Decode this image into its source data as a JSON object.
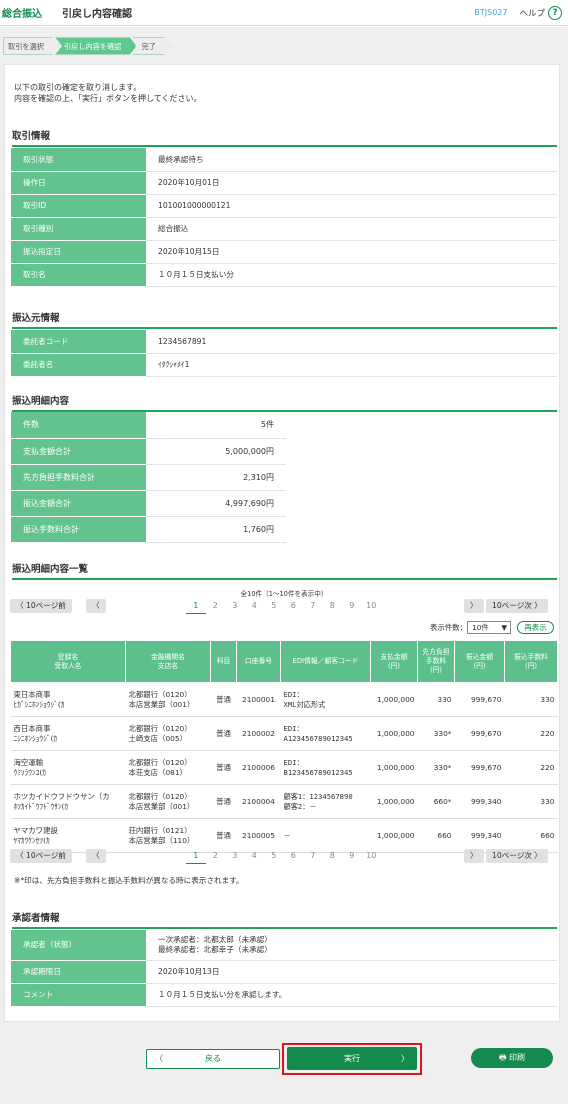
{
  "header": {
    "brand": "総合振込",
    "title": "引戻し内容確認",
    "screen_id": "BTJS027",
    "help": "ヘルプ",
    "help_icon": "?"
  },
  "steps": [
    "取引を選択",
    "引戻し内容を確認",
    "完了"
  ],
  "intro": [
    "以下の取引の確定を取り消します。",
    "内容を確認の上、「実行」ボタンを押してください。"
  ],
  "sections": {
    "txn": "取引情報",
    "from": "振込元情報",
    "detail": "振込明細内容",
    "list": "振込明細内容一覧",
    "approver": "承認者情報"
  },
  "txn": [
    [
      "取引状態",
      "最終承認待ち"
    ],
    [
      "操作日",
      "2020年10月01日"
    ],
    [
      "取引ID",
      "101001000000121"
    ],
    [
      "取引種別",
      "総合振込"
    ],
    [
      "振込指定日",
      "2020年10月15日"
    ],
    [
      "取引名",
      "１０月１５日支払い分"
    ]
  ],
  "from": [
    [
      "委託者コード",
      "1234567891"
    ],
    [
      "委託者名",
      "ｲﾀｸｼｬﾒｲ1"
    ]
  ],
  "detail": [
    [
      "件数",
      "5件"
    ],
    [
      "支払金額合計",
      "5,000,000円"
    ],
    [
      "先方負担手数料合計",
      "2,310円"
    ],
    [
      "振込金額合計",
      "4,997,690円"
    ],
    [
      "振込手数料合計",
      "1,760円"
    ]
  ],
  "pager": {
    "prev": "10ページ前",
    "next": "10ページ次",
    "pages": [
      "1",
      "2",
      "3",
      "4",
      "5",
      "6",
      "7",
      "8",
      "9",
      "10"
    ],
    "total": "全10件（1～10件を表示中）"
  },
  "display": {
    "label": "表示件数：",
    "value": "10件",
    "redisplay": "再表示"
  },
  "columns": [
    "登録名\n受取人名",
    "金融機関名\n支店名",
    "科目",
    "口座番号",
    "EDI情報／顧客コード",
    "支払金額\n(円)",
    "先方負担\n手数料\n(円)",
    "振込金額\n(円)",
    "振込手数料\n(円)"
  ],
  "rows": [
    [
      "東日本商事\nﾋｶﾞｼﾆﾎﾝｼｮｳｼﾞ(ｶ",
      "北都銀行（0120）\n本店営業部（001）",
      "普通",
      "2100001",
      "EDI：\nXML対応形式",
      "1,000,000",
      "330",
      "999,670",
      "330"
    ],
    [
      "西日本商事\nﾆｼﾆﾎﾝｼｮｳｼﾞ(ｶ",
      "北都銀行（0120）\n土崎支店（005）",
      "普通",
      "2100002",
      "EDI：\nA123456789012345",
      "1,000,000",
      "330*",
      "999,670",
      "220"
    ],
    [
      "海空運輸\nｳﾐｿﾗｳﾝﾕ(ｶ",
      "北都銀行（0120）\n本荘支店（081）",
      "普通",
      "2100006",
      "EDI：\nB123456789012345",
      "1,000,000",
      "330*",
      "999,670",
      "220"
    ],
    [
      "ホツカイドウフドウサン（カ\nﾎﾂｶｲﾄﾞｳﾌﾄﾞｳｻﾝ(ｶ",
      "北都銀行（0120）\n本店営業部（001）",
      "普通",
      "2100004",
      "顧客1：1234567890\n顧客2：－",
      "1,000,000",
      "660*",
      "999,340",
      "330"
    ],
    [
      "ヤマカワ建設\nﾔﾏｶﾜｹﾝｾﾂ(ｶ",
      "荘内銀行（0121）\n本店営業部（110）",
      "普通",
      "2100005",
      "－",
      "1,000,000",
      "660",
      "999,340",
      "660"
    ]
  ],
  "note": "※*印は、先方負担手数料と振込手数料が異なる時に表示されます。",
  "approver": [
    [
      "承認者（状態）",
      "一次承認者：北都太郎（未承認）\n最終承認者：北都幸子（未承認）"
    ],
    [
      "承認期限日",
      "2020年10月13日"
    ],
    [
      "コメント",
      "１０月１５日支払い分を承認します。"
    ]
  ],
  "buttons": {
    "back": "戻る",
    "execute": "実行",
    "print": "印刷"
  },
  "colors": {
    "accent": "#148a4e",
    "header_cell": "#62c38f",
    "highlight": "#e0141e"
  }
}
